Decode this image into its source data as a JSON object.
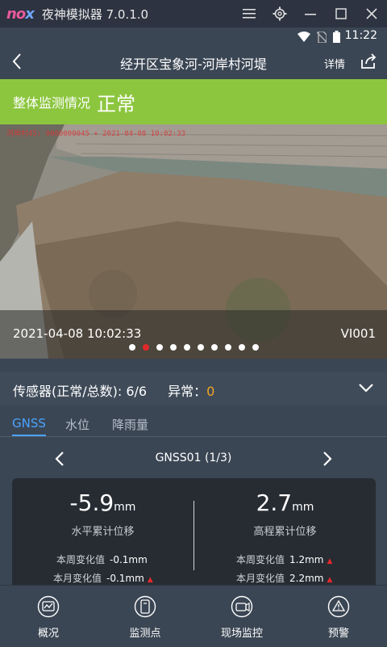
{
  "emulator": {
    "logo": "nox",
    "title": "夜神模拟器 7.0.1.0"
  },
  "status_bar": {
    "time": "11:22"
  },
  "header": {
    "title": "经开区宝象河-河岸村河堤",
    "detail_label": "详情"
  },
  "overall": {
    "label": "整体监测情况",
    "value": "正常"
  },
  "camera": {
    "timestamp": "2021-04-08 10:02:33",
    "id": "VI001",
    "stamp_text": "河岸村45: 0000000045 + 2021-04-08 10:02:33",
    "slide_count": 10,
    "active_slide": 1
  },
  "sensors": {
    "label": "传感器(正常/总数): 6/6",
    "abnormal_label": "异常：",
    "abnormal_value": "0"
  },
  "tabs": [
    {
      "label": "GNSS"
    },
    {
      "label": "水位"
    },
    {
      "label": "降雨量"
    }
  ],
  "pager": {
    "label": "GNSS01 (1/3)"
  },
  "metrics": {
    "horizontal": {
      "value": "-5.9",
      "unit": "mm",
      "name": "水平累计位移",
      "week_label": "本周变化值",
      "week_value": "-0.1mm",
      "month_label": "本月变化值",
      "month_value": "-0.1mm"
    },
    "elevation": {
      "value": "2.7",
      "unit": "mm",
      "name": "高程累计位移",
      "week_label": "本周变化值",
      "week_value": "1.2mm",
      "month_label": "本月变化值",
      "month_value": "2.2mm"
    }
  },
  "bottom_nav": [
    {
      "label": "概况",
      "icon": "overview-icon"
    },
    {
      "label": "监测点",
      "icon": "monitor-point-icon"
    },
    {
      "label": "现场监控",
      "icon": "camera-icon"
    },
    {
      "label": "预警",
      "icon": "warning-icon"
    }
  ],
  "colors": {
    "accent": "#4aa3ff",
    "banner": "#8cc63f",
    "abnormal": "#f5a623",
    "active_dot": "#e0292b"
  }
}
